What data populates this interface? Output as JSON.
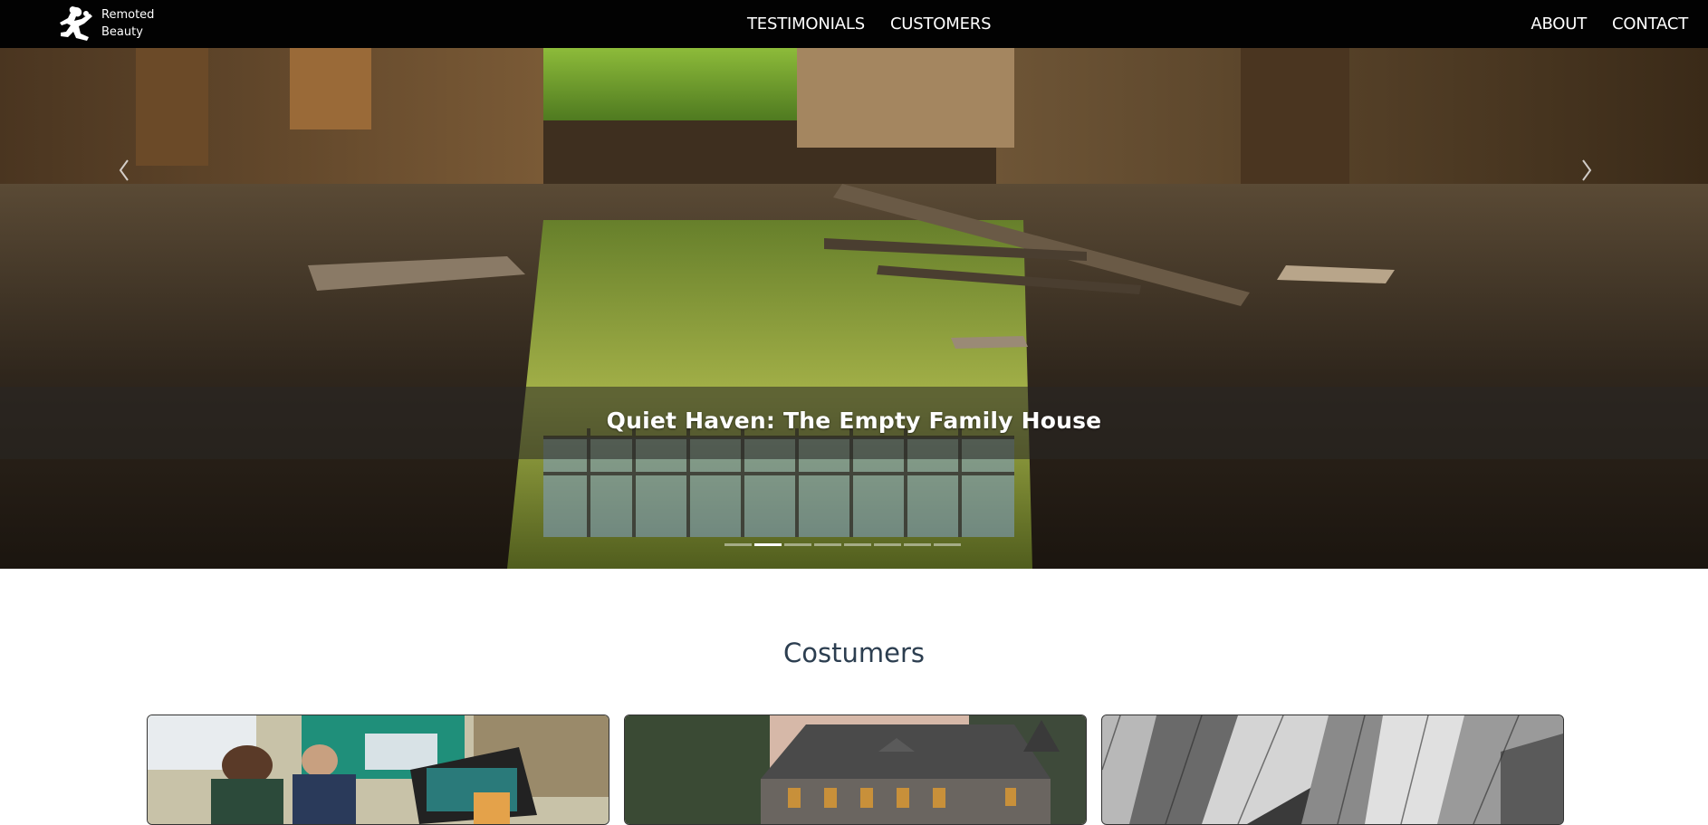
{
  "brand": {
    "line1": "Remoted",
    "line2": "Beauty"
  },
  "nav": {
    "center": [
      "TESTIMONIALS",
      "CUSTOMERS"
    ],
    "right": [
      "ABOUT",
      "CONTACT"
    ]
  },
  "carousel": {
    "caption": "Quiet Haven: The Empty Family House",
    "slide_count": 8,
    "active_slide": 2
  },
  "section": {
    "title": "Costumers"
  },
  "colors": {
    "navbar": "#020202",
    "section_title": "#2c3e50"
  }
}
